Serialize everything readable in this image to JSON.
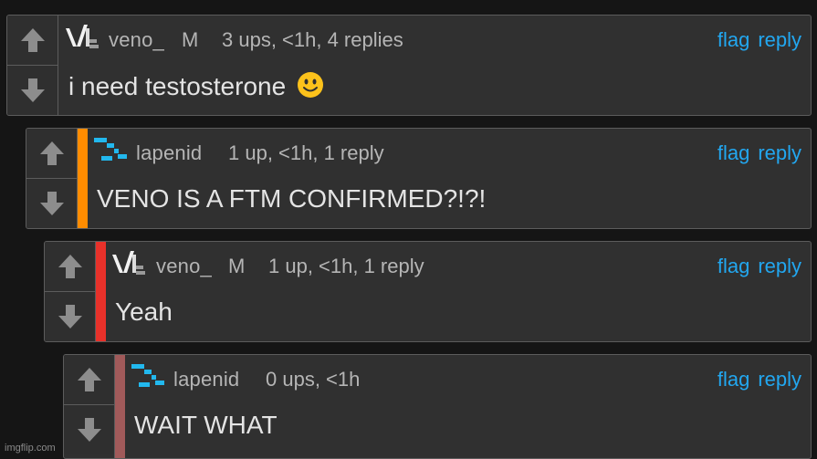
{
  "colors": {
    "background": "#151515",
    "panel": "#303030",
    "link": "#22a7f0",
    "bar_orange": "#ff8c00",
    "bar_red": "#e8312a",
    "bar_muted": "#a15a5a"
  },
  "comments": [
    {
      "username": "veno_",
      "gender": "M",
      "meta": "3 ups, <1h, 4 replies",
      "text": "i need testosterone",
      "emoji": "slightly-smiling-face",
      "flag": "flag",
      "reply": "reply",
      "avatar": "veno-avatar",
      "depth_bar_color": ""
    },
    {
      "username": "lapenid",
      "gender": "",
      "meta": "1 up, <1h, 1 reply",
      "text": "VENO IS A FTM CONFIRMED?!?!",
      "flag": "flag",
      "reply": "reply",
      "avatar": "lapenid-avatar",
      "depth_bar_color": "#ff8c00"
    },
    {
      "username": "veno_",
      "gender": "M",
      "meta": "1 up, <1h, 1 reply",
      "text": "Yeah",
      "flag": "flag",
      "reply": "reply",
      "avatar": "veno-avatar",
      "depth_bar_color": "#e8312a"
    },
    {
      "username": "lapenid",
      "gender": "",
      "meta": "0 ups, <1h",
      "text": "WAIT WHAT",
      "flag": "flag",
      "reply": "reply",
      "avatar": "lapenid-avatar",
      "depth_bar_color": "#a15a5a"
    }
  ],
  "watermark": "imgflip.com"
}
